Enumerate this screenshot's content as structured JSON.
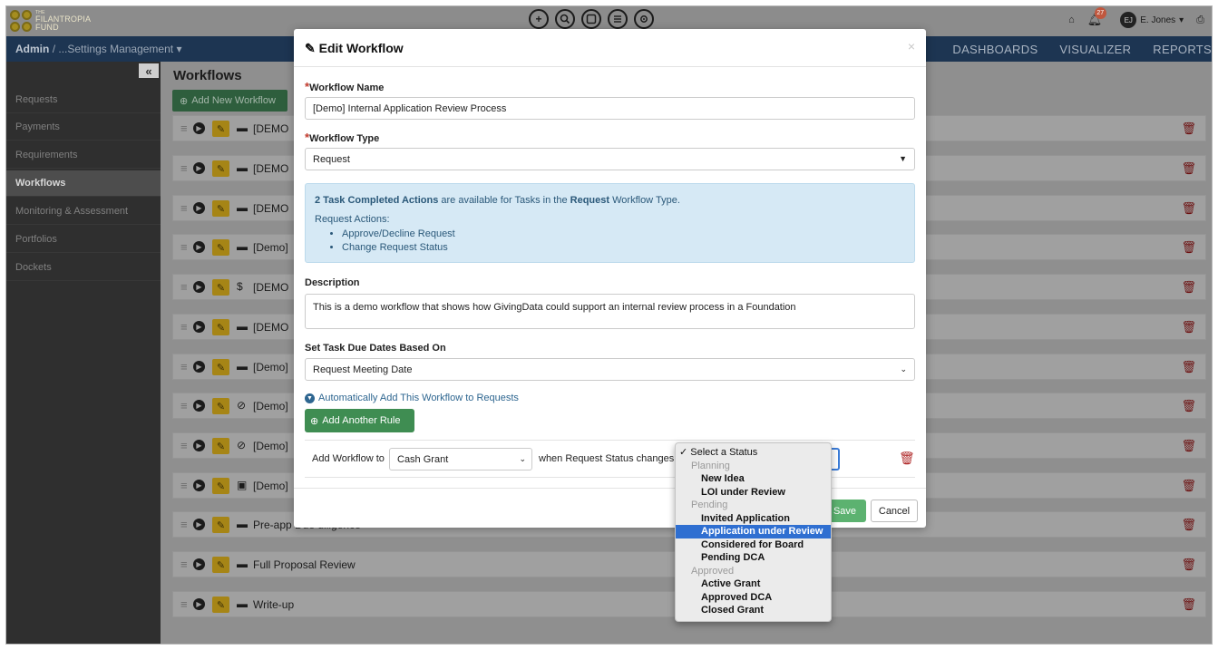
{
  "app": {
    "logo_small": "THE",
    "logo_line1": "FILANTROPIA",
    "logo_line2": "FUND",
    "top_icons": [
      "+",
      "search-icon",
      "note-icon",
      "list-icon",
      "gear-icon"
    ],
    "notifications_count": "27",
    "user_initials": "EJ",
    "user_name": "E. Jones"
  },
  "nav": {
    "crumb_root": "Admin",
    "crumb_sep": "/",
    "crumb_current": "...Settings Management",
    "links": [
      "DASHBOARDS",
      "VISUALIZER",
      "REPORTS"
    ]
  },
  "sidebar": {
    "collapse": "«",
    "items": [
      "Requests",
      "Payments",
      "Requirements",
      "Workflows",
      "Monitoring & Assessment",
      "Portfolios",
      "Dockets"
    ]
  },
  "main": {
    "title": "Workflows",
    "add_button": "Add New Workflow",
    "rows": [
      {
        "icon": "folder",
        "name": "[DEMO"
      },
      {
        "icon": "folder",
        "name": "[DEMO"
      },
      {
        "icon": "folder",
        "name": "[DEMO"
      },
      {
        "icon": "folder",
        "name": "[Demo]"
      },
      {
        "icon": "dollar",
        "name": "[DEMO"
      },
      {
        "icon": "folder",
        "name": "[DEMO"
      },
      {
        "icon": "folder",
        "name": "[Demo]"
      },
      {
        "icon": "ban",
        "name": "[Demo]"
      },
      {
        "icon": "ban",
        "name": "[Demo]"
      },
      {
        "icon": "doc",
        "name": "[Demo]"
      },
      {
        "icon": "folder",
        "name": "Pre-app Due diligence"
      },
      {
        "icon": "folder",
        "name": "Full Proposal Review"
      },
      {
        "icon": "folder",
        "name": "Write-up"
      }
    ]
  },
  "modal": {
    "title": "Edit Workflow",
    "close": "×",
    "name_label": "Workflow Name",
    "name_value": "[Demo] Internal  Application Review Process",
    "type_label": "Workflow Type",
    "type_value": "Request",
    "info": {
      "count_text": "2 Task Completed Actions",
      "mid_text": " are available for Tasks in the ",
      "type_text": "Request",
      "end_text": " Workflow Type.",
      "actions_label": "Request Actions:",
      "actions": [
        "Approve/Decline Request",
        "Change Request Status"
      ]
    },
    "description_label": "Description",
    "description_value": "This is a demo workflow that shows how GivingData could support an internal review process in a Foundation",
    "due_label": "Set Task Due Dates Based On",
    "due_value": "Request Meeting Date",
    "auto_link": "Automatically Add This Workflow to Requests",
    "add_rule": "Add Another Rule",
    "rule": {
      "prefix": "Add Workflow to",
      "grant_type": "Cash Grant",
      "middle": "when Request Status changes to"
    },
    "save": "Save",
    "cancel": "Cancel"
  },
  "status_dropdown": {
    "items": [
      {
        "label": "✓ Select a Status",
        "kind": "first"
      },
      {
        "label": "Planning",
        "kind": "group"
      },
      {
        "label": "New Idea",
        "kind": "option"
      },
      {
        "label": "LOI under Review",
        "kind": "option"
      },
      {
        "label": "Pending",
        "kind": "group"
      },
      {
        "label": "Invited Application",
        "kind": "option"
      },
      {
        "label": "Application under Review",
        "kind": "selected"
      },
      {
        "label": "Considered for Board",
        "kind": "option"
      },
      {
        "label": "Pending DCA",
        "kind": "option"
      },
      {
        "label": "Approved",
        "kind": "group"
      },
      {
        "label": "Active Grant",
        "kind": "option"
      },
      {
        "label": "Approved DCA",
        "kind": "option"
      },
      {
        "label": "Closed Grant",
        "kind": "option"
      }
    ]
  }
}
